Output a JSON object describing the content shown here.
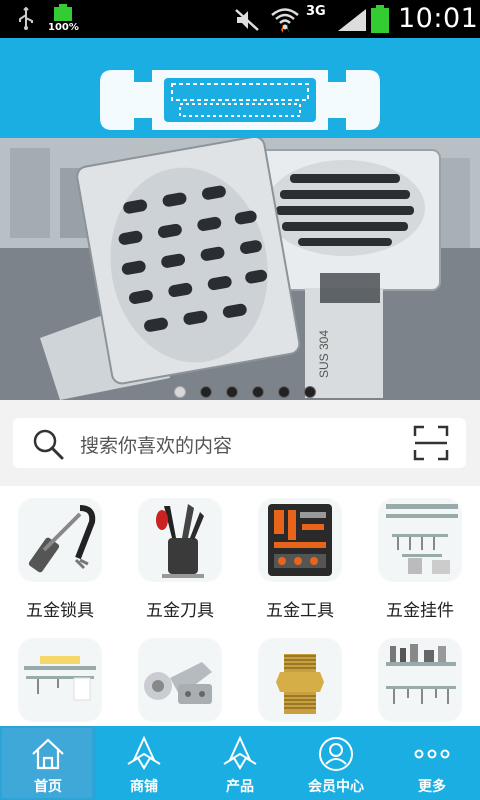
{
  "status_bar": {
    "battery_percent": "100%",
    "network": "3G",
    "time": "10:01"
  },
  "search": {
    "placeholder": "搜索你喜欢的内容"
  },
  "banner": {
    "engraving": "SUS 304",
    "slide_count": 6,
    "active_slide": 1
  },
  "categories": [
    {
      "label": "五金锁具",
      "icon": "lock-icon"
    },
    {
      "label": "五金刀具",
      "icon": "knife-icon"
    },
    {
      "label": "五金工具",
      "icon": "toolbox-icon"
    },
    {
      "label": "五金挂件",
      "icon": "rack-icon"
    },
    {
      "label": "",
      "icon": "towel-rack-icon"
    },
    {
      "label": "",
      "icon": "hinge-icon"
    },
    {
      "label": "",
      "icon": "pipe-fitting-icon"
    },
    {
      "label": "",
      "icon": "kitchen-rack-icon"
    }
  ],
  "nav": {
    "items": [
      {
        "label": "首页",
        "icon": "home-icon"
      },
      {
        "label": "商铺",
        "icon": "shop-icon"
      },
      {
        "label": "产品",
        "icon": "product-icon"
      },
      {
        "label": "会员中心",
        "icon": "member-icon"
      },
      {
        "label": "更多",
        "icon": "more-icon"
      }
    ],
    "active_index": 0
  },
  "colors": {
    "brand": "#1aaee3",
    "status_bar": "#000000",
    "background": "#f2f2f2"
  }
}
